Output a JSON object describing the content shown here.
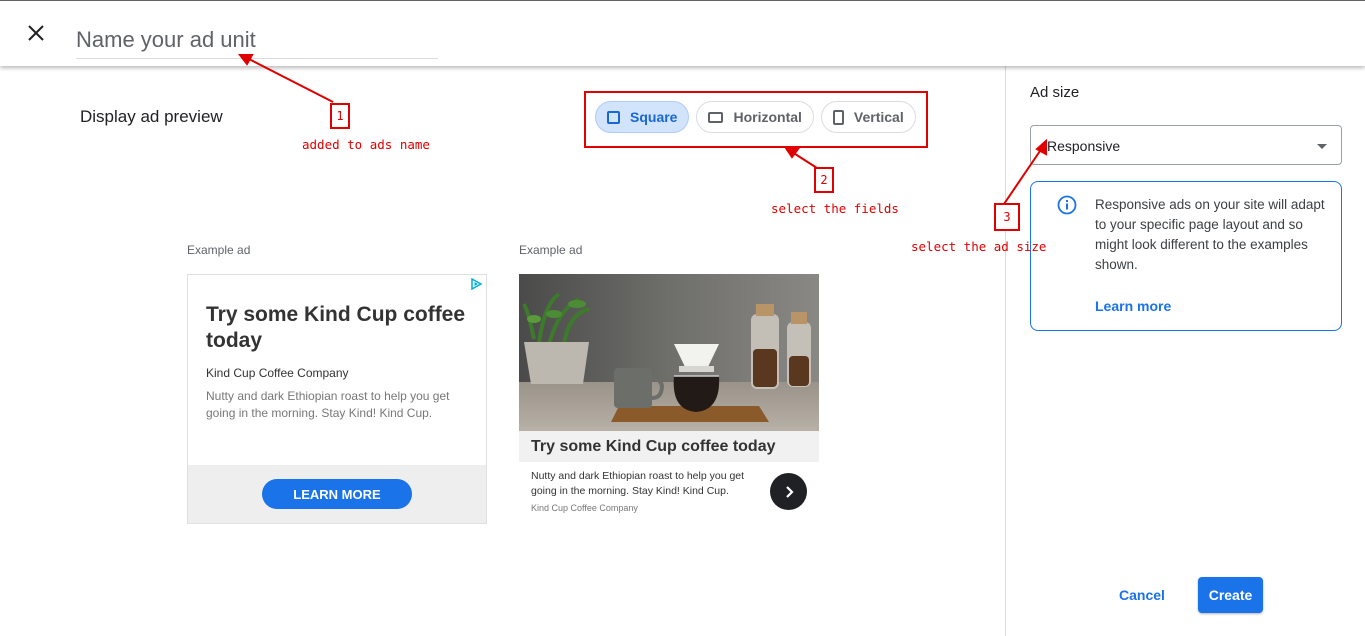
{
  "header": {
    "close_icon": "close-icon",
    "name_placeholder": "Name your ad unit"
  },
  "preview": {
    "title": "Display ad preview",
    "shape_options": [
      {
        "label": "Square",
        "icon": "square-icon",
        "selected": true
      },
      {
        "label": "Horizontal",
        "icon": "horizontal-rect-icon",
        "selected": false
      },
      {
        "label": "Vertical",
        "icon": "vertical-rect-icon",
        "selected": false
      }
    ],
    "example_label": "Example ad",
    "text_ad": {
      "title": "Try some Kind Cup coffee today",
      "company": "Kind Cup Coffee Company",
      "description": "Nutty and dark Ethiopian roast to help you get going in the morning. Stay Kind! Kind Cup.",
      "cta": "LEARN MORE",
      "adchoices_icon": "adchoices-icon"
    },
    "image_ad": {
      "title": "Try some Kind Cup coffee today",
      "description": "Nutty and dark Ethiopian roast to help you get going in the morning. Stay Kind! Kind Cup.",
      "company": "Kind Cup Coffee Company",
      "arrow_icon": "chevron-right-icon"
    }
  },
  "sidebar": {
    "ad_size_label": "Ad size",
    "ad_size_value": "Responsive",
    "info_text": "Responsive ads on your site will adapt to your specific page layout and so might look different to the examples shown.",
    "learn_more": "Learn more",
    "cancel": "Cancel",
    "create": "Create"
  },
  "annotations": [
    {
      "number": "1",
      "text": "added to ads name"
    },
    {
      "number": "2",
      "text": "select the fields"
    },
    {
      "number": "3",
      "text": "select the ad size"
    }
  ],
  "colors": {
    "accent": "#1a73e8",
    "chip_active_bg": "#d2e3fc",
    "annotation": "#e00000"
  }
}
